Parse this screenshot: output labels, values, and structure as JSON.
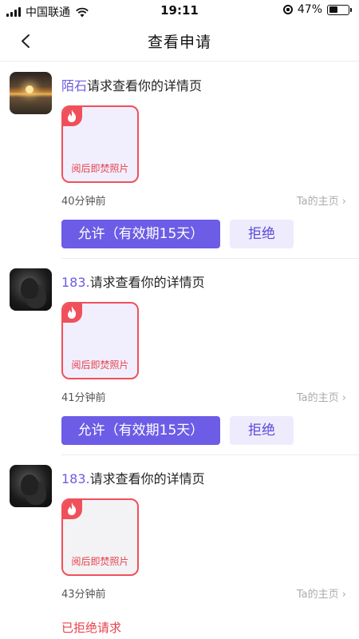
{
  "status_bar": {
    "carrier": "中国联通",
    "time": "19:11",
    "battery": "47%",
    "battery_level": 0.47
  },
  "header": {
    "title": "查看申请"
  },
  "requests": [
    {
      "name": "陌石",
      "action": "请求查看你的详情页",
      "avatar": "sunset-photo",
      "photo_label": "阅后即焚照片",
      "time": "40分钟前",
      "home_link": "Ta的主页",
      "allow_label": "允许（有效期15天）",
      "reject_label": "拒绝"
    },
    {
      "name": "183.",
      "action": "请求查看你的详情页",
      "avatar": "dark-portrait",
      "photo_label": "阅后即焚照片",
      "time": "41分钟前",
      "home_link": "Ta的主页",
      "allow_label": "允许（有效期15天）",
      "reject_label": "拒绝"
    },
    {
      "name": "183.",
      "action": "请求查看你的详情页",
      "avatar": "dark-portrait",
      "photo_label": "阅后即焚照片",
      "time": "43分钟前",
      "home_link": "Ta的主页",
      "status": "已拒绝请求"
    }
  ],
  "colors": {
    "accent": "#6d5ce6",
    "name": "#6c5ce0",
    "burn_red": "#f0505a",
    "reject_bg": "#eeebfd"
  }
}
